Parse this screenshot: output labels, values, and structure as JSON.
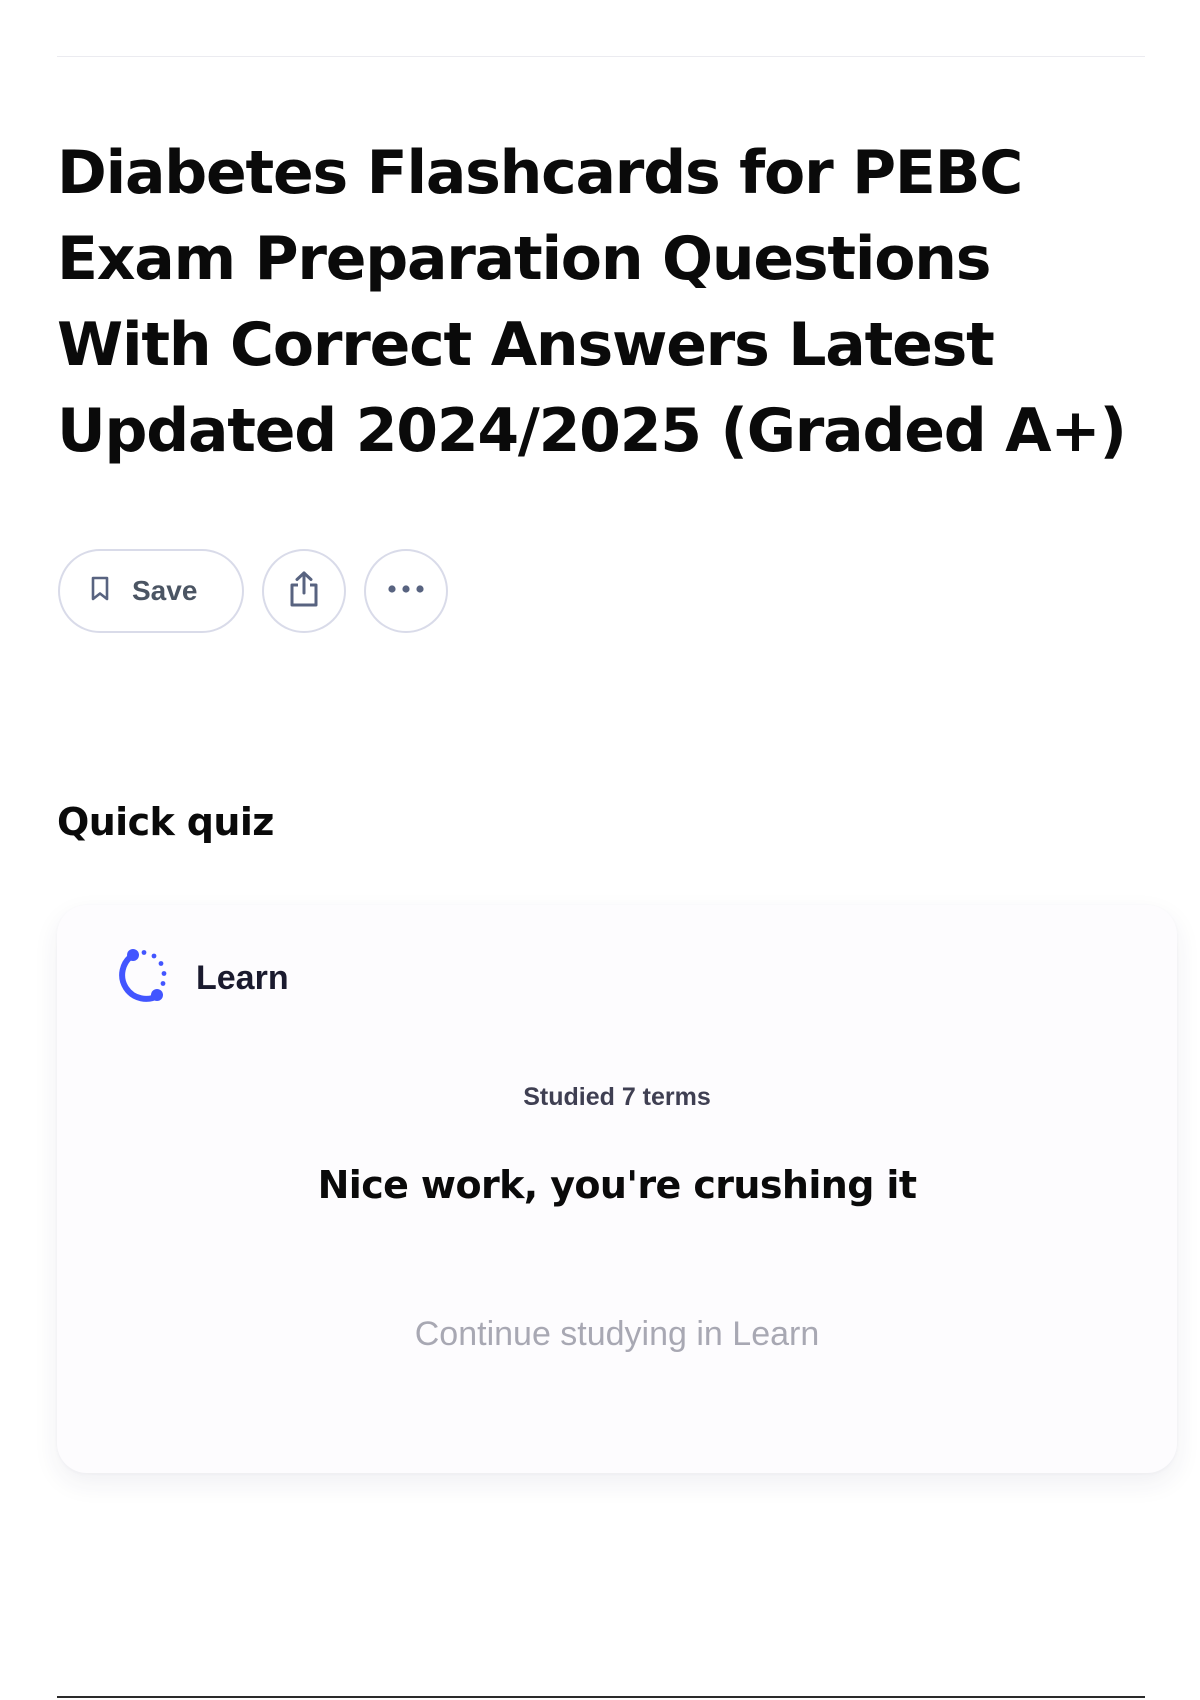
{
  "set": {
    "title": "Diabetes Flashcards for PEBC Exam Preparation Questions With Correct Answers Latest Updated 2024/2025 (Graded A+)"
  },
  "actions": {
    "save_label": "Save",
    "save_icon": "bookmark-icon",
    "share_icon": "share-icon",
    "more_icon": "more-options-icon"
  },
  "quick_quiz": {
    "section_title": "Quick quiz",
    "mode_icon": "learn-icon",
    "mode_label": "Learn",
    "studied_text": "Studied 7 terms",
    "message": "Nice work, you're crushing it",
    "continue_label": "Continue studying in Learn"
  },
  "colors": {
    "accent": "#4255ff",
    "text_primary": "#0a0a0a",
    "text_muted": "#a8a8b3",
    "border": "#d9dbe9"
  }
}
